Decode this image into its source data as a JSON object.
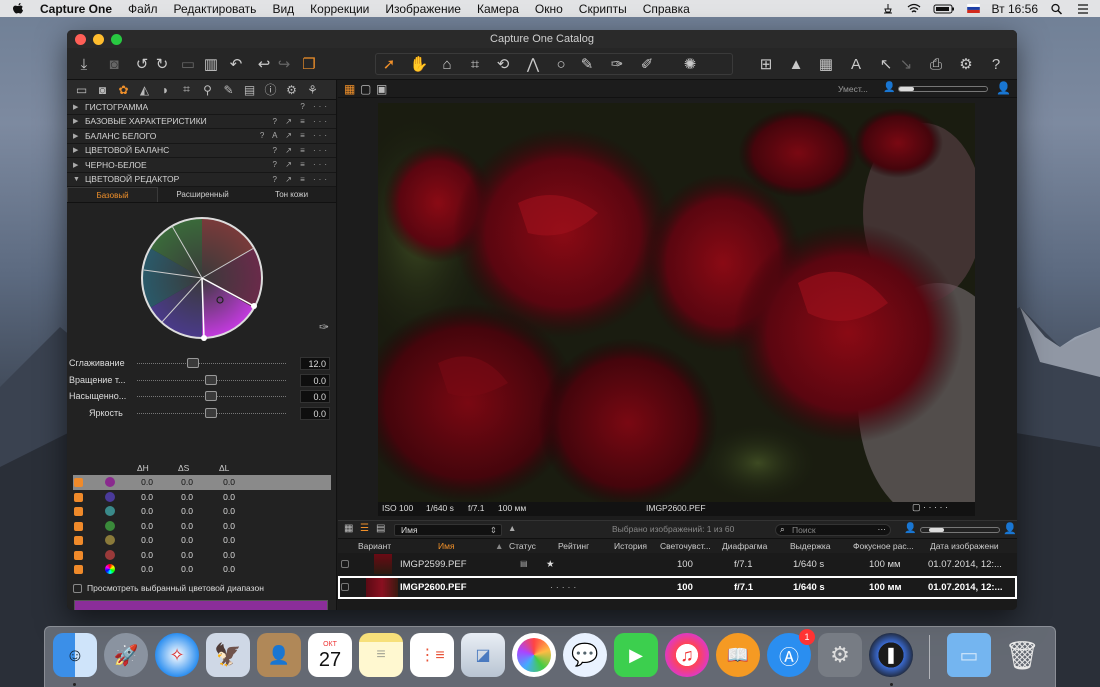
{
  "menubar": {
    "app_name": "Capture One",
    "items": [
      "Файл",
      "Редактировать",
      "Вид",
      "Коррекции",
      "Изображение",
      "Камера",
      "Окно",
      "Скрипты",
      "Справка"
    ],
    "clock": "Вт 16:56"
  },
  "window": {
    "title": "Capture One Catalog"
  },
  "left_panel": {
    "sections": [
      {
        "label": "ГИСТОГРАММА",
        "expanded": false
      },
      {
        "label": "БАЗОВЫЕ ХАРАКТЕРИСТИКИ",
        "expanded": false
      },
      {
        "label": "БАЛАНС БЕЛОГО",
        "expanded": false
      },
      {
        "label": "ЦВЕТОВОЙ БАЛАНС",
        "expanded": false
      },
      {
        "label": "ЧЕРНО-БЕЛОЕ",
        "expanded": false
      },
      {
        "label": "ЦВЕТОВОЙ РЕДАКТОР",
        "expanded": true
      }
    ],
    "color_editor": {
      "tabs": [
        "Базовый",
        "Расширенный",
        "Тон кожи"
      ],
      "active_tab": "Базовый",
      "sliders": [
        {
          "label": "Сглаживание",
          "value": "12.0",
          "pos": 0.38
        },
        {
          "label": "Вращение т...",
          "value": "0.0",
          "pos": 0.5
        },
        {
          "label": "Насыщенно...",
          "value": "0.0",
          "pos": 0.5
        },
        {
          "label": "Яркость",
          "value": "0.0",
          "pos": 0.5
        }
      ],
      "delta_headers": [
        "ΔH",
        "ΔS",
        "ΔL"
      ],
      "rows": [
        {
          "color": "#8a2a8e",
          "dh": "0.0",
          "ds": "0.0",
          "dl": "0.0",
          "selected": true
        },
        {
          "color": "#4a3a9a",
          "dh": "0.0",
          "ds": "0.0",
          "dl": "0.0",
          "selected": false
        },
        {
          "color": "#3a8a8a",
          "dh": "0.0",
          "ds": "0.0",
          "dl": "0.0",
          "selected": false
        },
        {
          "color": "#3a8a3a",
          "dh": "0.0",
          "ds": "0.0",
          "dl": "0.0",
          "selected": false
        },
        {
          "color": "#8a7a3a",
          "dh": "0.0",
          "ds": "0.0",
          "dl": "0.0",
          "selected": false
        },
        {
          "color": "#9a3a3a",
          "dh": "0.0",
          "ds": "0.0",
          "dl": "0.0",
          "selected": false
        },
        {
          "color": "rainbow",
          "dh": "0.0",
          "ds": "0.0",
          "dl": "0.0",
          "selected": false
        }
      ],
      "view_selected_label": "Просмотреть выбранный цветовой диапазон",
      "swatch_color": "#8b2e9a"
    }
  },
  "viewer": {
    "fit_label": "Умест...",
    "meta": {
      "iso": "ISO 100",
      "shutter": "1/640 s",
      "aperture": "f/7.1",
      "focal": "100 мм",
      "filename": "IMGP2600.PEF"
    }
  },
  "browser": {
    "sort_field": "Имя",
    "selection_text": "Выбрано изображений: 1 из 60",
    "search_placeholder": "Поиск",
    "columns": [
      "Вариант",
      "Имя",
      "Статус",
      "Рейтинг",
      "История",
      "Светочувст...",
      "Диафрагма",
      "Выдержка",
      "Фокусное рас...",
      "Дата изображени"
    ],
    "rows": [
      {
        "name": "IMGP2599.PEF",
        "rating": "★",
        "iso": "100",
        "aperture": "f/7.1",
        "shutter": "1/640 s",
        "focal": "100 мм",
        "date": "01.07.2014, 12:...",
        "selected": false
      },
      {
        "name": "IMGP2600.PEF",
        "rating": "· · · · ·",
        "iso": "100",
        "aperture": "f/7.1",
        "shutter": "1/640 s",
        "focal": "100 мм",
        "date": "01.07.2014, 12:...",
        "selected": true
      }
    ]
  },
  "dock": {
    "calendar_month": "ОКТ",
    "calendar_day": "27",
    "appstore_badge": "1",
    "apps": [
      "finder-icon",
      "launchpad-icon",
      "safari-icon",
      "mail-icon",
      "contacts-icon",
      "calendar-icon",
      "notes-icon",
      "reminders-icon",
      "photo-booth-icon",
      "photos-icon",
      "messages-icon",
      "facetime-icon",
      "itunes-icon",
      "ibooks-icon",
      "app-store-icon",
      "system-preferences-icon",
      "capture-one-icon",
      "folder-icon",
      "trash-icon"
    ]
  }
}
